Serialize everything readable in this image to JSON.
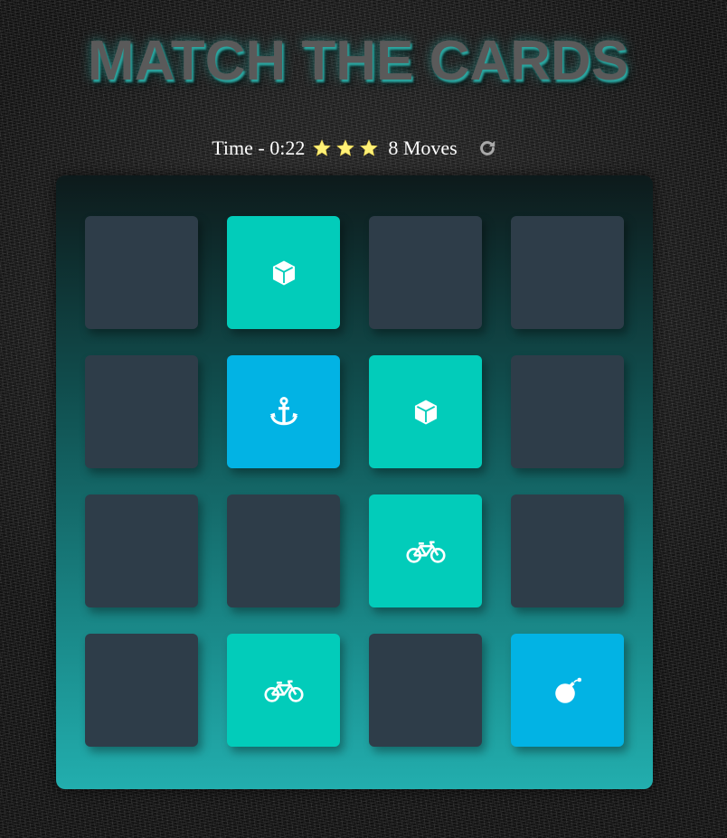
{
  "title": "MATCH THE CARDS",
  "score_panel": {
    "time_text": "Time - 0:22",
    "stars": [
      {
        "icon": "star-icon",
        "filled": true
      },
      {
        "icon": "star-icon",
        "filled": true
      },
      {
        "icon": "star-icon",
        "filled": true
      }
    ],
    "moves_text": "8 Moves",
    "restart_icon": "refresh-icon"
  },
  "colors": {
    "card_back": "#2e3d49",
    "card_match": "#02ccba",
    "card_open": "#02b3e4",
    "star": "#fff176"
  },
  "cards": [
    {
      "state": "hidden",
      "icon": ""
    },
    {
      "state": "match",
      "icon": "cube-icon"
    },
    {
      "state": "hidden",
      "icon": ""
    },
    {
      "state": "hidden",
      "icon": ""
    },
    {
      "state": "hidden",
      "icon": ""
    },
    {
      "state": "open",
      "icon": "anchor-icon"
    },
    {
      "state": "match",
      "icon": "cube-icon"
    },
    {
      "state": "hidden",
      "icon": ""
    },
    {
      "state": "hidden",
      "icon": ""
    },
    {
      "state": "hidden",
      "icon": ""
    },
    {
      "state": "match",
      "icon": "bicycle-icon"
    },
    {
      "state": "hidden",
      "icon": ""
    },
    {
      "state": "hidden",
      "icon": ""
    },
    {
      "state": "match",
      "icon": "bicycle-icon"
    },
    {
      "state": "hidden",
      "icon": ""
    },
    {
      "state": "open",
      "icon": "bomb-icon"
    }
  ]
}
